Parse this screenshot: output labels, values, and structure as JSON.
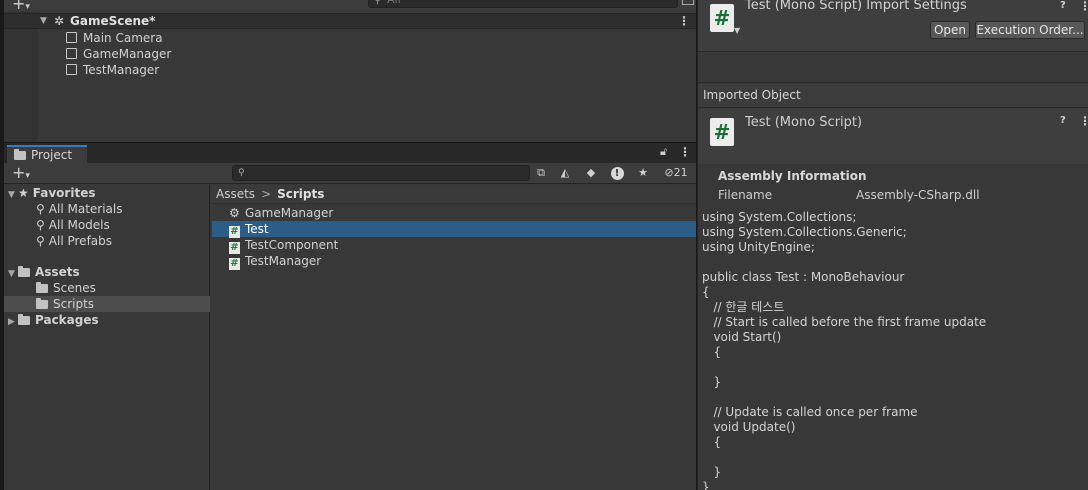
{
  "hierarchy": {
    "search_placeholder": "All",
    "scene": "GameScene*",
    "items": [
      "Main Camera",
      "GameManager",
      "TestManager"
    ]
  },
  "project": {
    "tab_label": "Project",
    "hidden_count": "21",
    "tree": {
      "favorites": "Favorites",
      "favorite_items": [
        "All Materials",
        "All Models",
        "All Prefabs"
      ],
      "assets": "Assets",
      "asset_folders": [
        "Scenes",
        "Scripts"
      ],
      "packages": "Packages"
    },
    "breadcrumb": {
      "root": "Assets",
      "separator": ">",
      "current": "Scripts"
    },
    "files": [
      {
        "name": "GameManager",
        "icon": "gear-icon"
      },
      {
        "name": "Test",
        "icon": "csharp-script-icon"
      },
      {
        "name": "TestComponent",
        "icon": "csharp-script-icon"
      },
      {
        "name": "TestManager",
        "icon": "csharp-script-icon"
      }
    ]
  },
  "inspector": {
    "title": "Test (Mono Script) Import Settings",
    "open_button": "Open",
    "execution_order_button": "Execution Order...",
    "imported_object_label": "Imported Object",
    "object_title": "Test (Mono Script)",
    "assembly_heading": "Assembly Information",
    "filename_label": "Filename",
    "filename_value": "Assembly-CSharp.dll",
    "code_lines": [
      "using System.Collections;",
      "using System.Collections.Generic;",
      "using UnityEngine;",
      "",
      "public class Test : MonoBehaviour",
      "{",
      "   // 한글 테스트",
      "   // Start is called before the first frame update",
      "   void Start()",
      "   {",
      "",
      "   }",
      "",
      "   // Update is called once per frame",
      "   void Update()",
      "   {",
      "",
      "   }",
      "}"
    ]
  },
  "colors": {
    "selection": "#2c5d87",
    "tab_accent": "#3a79bb",
    "script_icon_green": "#1a6f36"
  }
}
